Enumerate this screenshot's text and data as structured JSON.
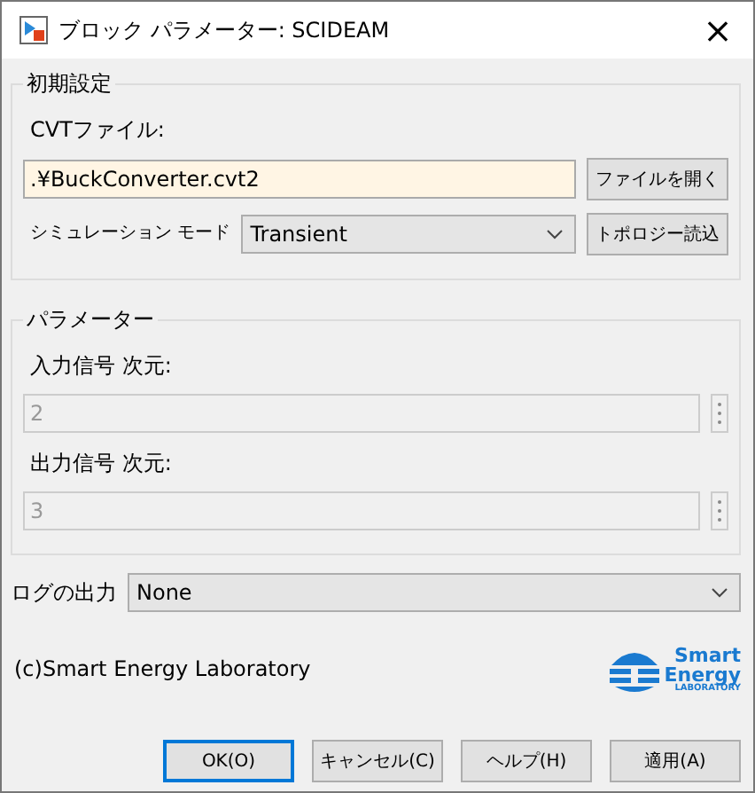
{
  "window": {
    "title": "ブロック パラメーター: SCIDEAM",
    "close": "×"
  },
  "initial_settings": {
    "legend": "初期設定",
    "file_label": "CVTファイル:",
    "file_value": ".¥BuckConverter.cvt2",
    "open_button": "ファイルを開く",
    "mode_label": "シミュレーション モード",
    "mode_value": "Transient",
    "topology_button": "トポロジー読込"
  },
  "parameters": {
    "legend": "パラメーター",
    "fields": [
      {
        "label": "入力信号 次元:",
        "value": "2",
        "disabled": true
      },
      {
        "label": "出力信号 次元:",
        "value": "3",
        "disabled": true
      }
    ]
  },
  "log": {
    "label": "ログの出力",
    "value": "None"
  },
  "copyright": "(c)Smart Energy Laboratory",
  "logo": {
    "line1": "Smart",
    "line2": "Energy",
    "line3": "LABORATORY"
  },
  "buttons": [
    {
      "label": "OK(O)",
      "default": true
    },
    {
      "label": "キャンセル(C)",
      "default": false
    },
    {
      "label": "ヘルプ(H)",
      "default": false
    },
    {
      "label": "適用(A)",
      "default": false
    }
  ]
}
